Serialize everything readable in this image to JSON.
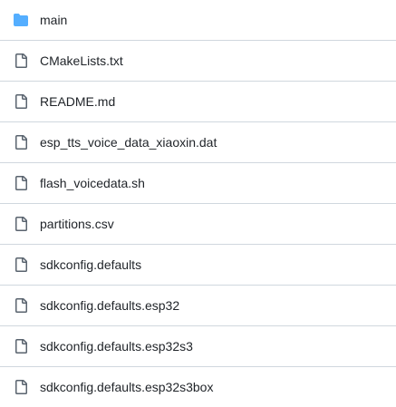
{
  "colors": {
    "folder": "#54aeff",
    "file_icon": "#59636e",
    "text": "#1f2328",
    "divider": "#d0d7de"
  },
  "items": [
    {
      "name": "main",
      "kind": "folder",
      "icon": "folder-icon"
    },
    {
      "name": "CMakeLists.txt",
      "kind": "file",
      "icon": "file-icon"
    },
    {
      "name": "README.md",
      "kind": "file",
      "icon": "file-icon"
    },
    {
      "name": "esp_tts_voice_data_xiaoxin.dat",
      "kind": "file",
      "icon": "file-icon"
    },
    {
      "name": "flash_voicedata.sh",
      "kind": "file",
      "icon": "file-icon"
    },
    {
      "name": "partitions.csv",
      "kind": "file",
      "icon": "file-icon"
    },
    {
      "name": "sdkconfig.defaults",
      "kind": "file",
      "icon": "file-icon"
    },
    {
      "name": "sdkconfig.defaults.esp32",
      "kind": "file",
      "icon": "file-icon"
    },
    {
      "name": "sdkconfig.defaults.esp32s3",
      "kind": "file",
      "icon": "file-icon"
    },
    {
      "name": "sdkconfig.defaults.esp32s3box",
      "kind": "file",
      "icon": "file-icon"
    }
  ]
}
